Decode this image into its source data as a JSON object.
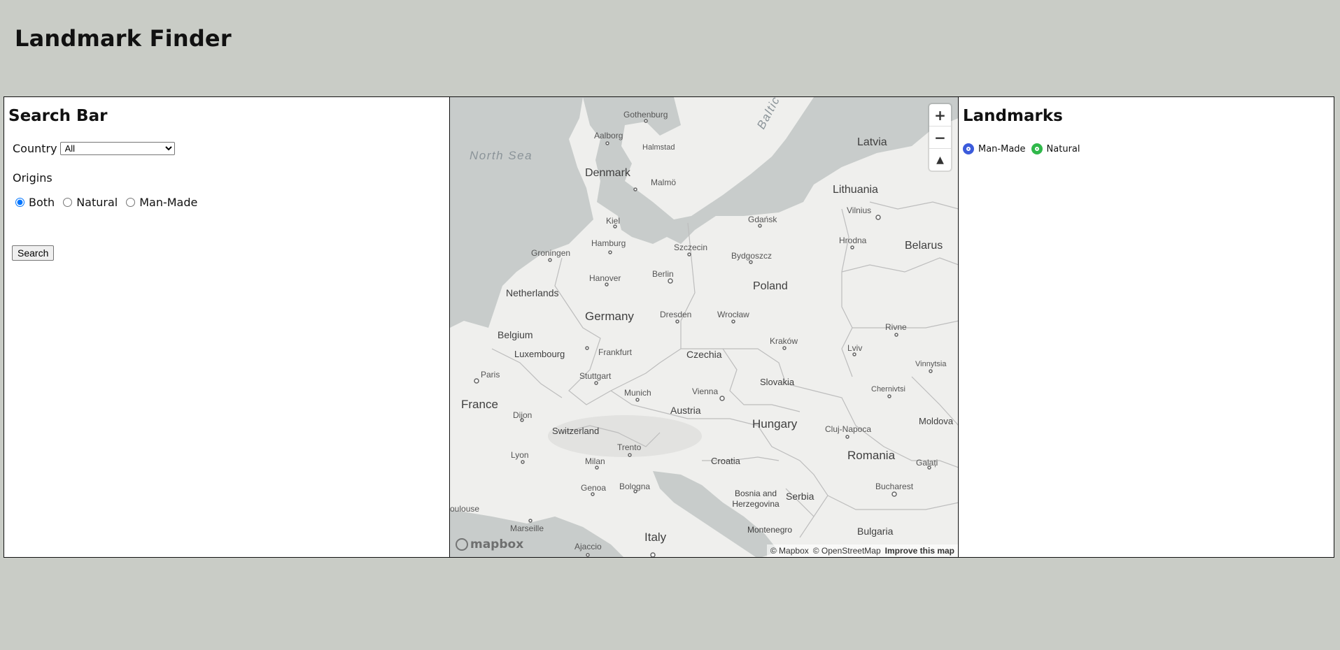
{
  "app": {
    "title": "Landmark Finder"
  },
  "search_panel": {
    "heading": "Search Bar",
    "country_label": "Country",
    "country_selected": "All",
    "origins_label": "Origins",
    "origin_options": [
      "Both",
      "Natural",
      "Man-Made"
    ],
    "origin_selected": "Both",
    "search_button": "Search"
  },
  "map": {
    "zoom_in": "+",
    "zoom_out": "−",
    "compass": "▲",
    "logo_text": "mapbox",
    "attribution_mapbox": "© Mapbox",
    "attribution_osm": "© OpenStreetMap",
    "attribution_improve": "Improve this map",
    "labels": {
      "north_sea": "North Sea",
      "baltic_sea": "Baltic Sea",
      "denmark": "Denmark",
      "latvia": "Latvia",
      "lithuania": "Lithuania",
      "belarus": "Belarus",
      "poland": "Poland",
      "netherlands": "Netherlands",
      "germany": "Germany",
      "belgium": "Belgium",
      "luxembourg": "Luxembourg",
      "czechia": "Czechia",
      "slovakia": "Slovakia",
      "france": "France",
      "austria": "Austria",
      "hungary": "Hungary",
      "switzerland": "Switzerland",
      "moldova": "Moldova",
      "romania": "Romania",
      "croatia": "Croatia",
      "bosnia": "Bosnia and Herzegovina",
      "serbia": "Serbia",
      "montenegro": "Montenegro",
      "bulgaria": "Bulgaria",
      "italy": "Italy",
      "gothenburg": "Gothenburg",
      "aalborg": "Aalborg",
      "halmstad": "Halmstad",
      "malmo": "Malmö",
      "kiel": "Kiel",
      "gdansk": "Gdańsk",
      "vilnius": "Vilnius",
      "hamburg": "Hamburg",
      "szczecin": "Szczecin",
      "bydgoszcz": "Bydgoszcz",
      "hrodna": "Hrodna",
      "groningen": "Groningen",
      "hanover": "Hanover",
      "berlin": "Berlin",
      "dresden": "Dresden",
      "wroclaw": "Wrocław",
      "rivne": "Rivne",
      "frankfurt": "Frankfurt",
      "krakow": "Kraków",
      "lviv": "Lviv",
      "paris": "Paris",
      "stuttgart": "Stuttgart",
      "vinnytsia": "Vinnytsia",
      "munich": "Munich",
      "vienna": "Vienna",
      "chernivtsi": "Chernivtsi",
      "dijon": "Dijon",
      "cluj": "Cluj-Napoca",
      "trento": "Trento",
      "lyon": "Lyon",
      "milan": "Milan",
      "galati": "Galați",
      "genoa": "Genoa",
      "bologna": "Bologna",
      "bucharest": "Bucharest",
      "toulouse": "oulouse",
      "marseille": "Marseille",
      "ajaccio": "Ajaccio"
    }
  },
  "landmarks_panel": {
    "heading": "Landmarks",
    "legend": [
      {
        "label": "Man-Made",
        "color": "#3b5bdb"
      },
      {
        "label": "Natural",
        "color": "#2fb84a"
      }
    ]
  },
  "colors": {
    "page_background": "#c9ccc6",
    "panel_background": "#ffffff",
    "map_land": "#efefed",
    "map_water": "#c8cccb"
  }
}
